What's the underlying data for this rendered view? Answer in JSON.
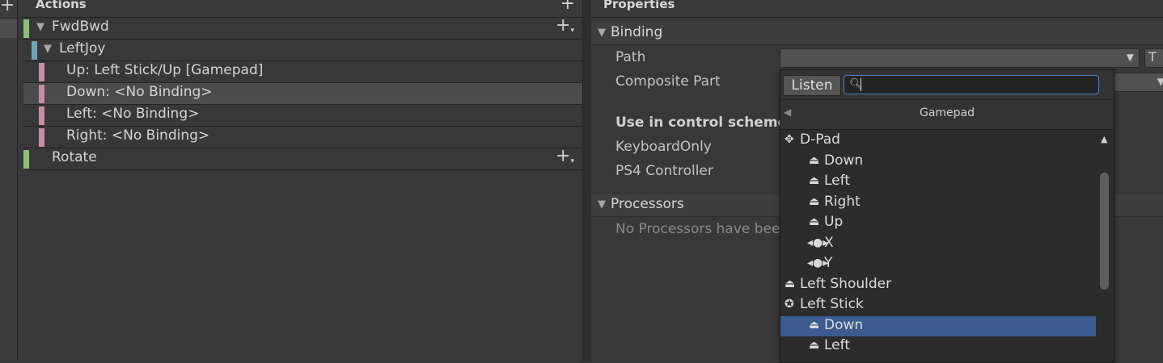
{
  "actions_panel": {
    "title": "Actions",
    "rows": [
      {
        "label": "FwdBwd",
        "type": "action"
      },
      {
        "label": "LeftJoy",
        "type": "composite"
      },
      {
        "label": "Up: Left Stick/Up [Gamepad]",
        "type": "part"
      },
      {
        "label": "Down: <No Binding>",
        "type": "part",
        "selected": true
      },
      {
        "label": "Left: <No Binding>",
        "type": "part"
      },
      {
        "label": "Right: <No Binding>",
        "type": "part"
      },
      {
        "label": "Rotate",
        "type": "action"
      }
    ],
    "colors": {
      "action": "#8cc07a",
      "composite": "#6fa3b5",
      "part": "#c98aa8"
    }
  },
  "properties_panel": {
    "title": "Properties",
    "binding_section": "Binding",
    "path_label": "Path",
    "composite_part_label": "Composite Part",
    "control_schemes_label": "Use in control scheme",
    "schemes": [
      "KeyboardOnly",
      "PS4 Controller"
    ],
    "processors_section": "Processors",
    "no_processors_text": "No Processors have bee",
    "t_button": "T"
  },
  "dropdown": {
    "listen_label": "Listen",
    "search_value": "",
    "crumb": "Gamepad",
    "items": [
      {
        "label": "D-Pad",
        "icon": "dpad-icon",
        "indent": 0
      },
      {
        "label": "Down",
        "icon": "button-icon",
        "indent": 1
      },
      {
        "label": "Left",
        "icon": "button-icon",
        "indent": 1
      },
      {
        "label": "Right",
        "icon": "button-icon",
        "indent": 1
      },
      {
        "label": "Up",
        "icon": "button-icon",
        "indent": 1
      },
      {
        "label": "X",
        "icon": "axis-icon",
        "indent": 1
      },
      {
        "label": "Y",
        "icon": "axis-icon",
        "indent": 1
      },
      {
        "label": "Left Shoulder",
        "icon": "button-icon",
        "indent": 0
      },
      {
        "label": "Left Stick",
        "icon": "stick-icon",
        "indent": 0
      },
      {
        "label": "Down",
        "icon": "button-icon",
        "indent": 1,
        "selected": true
      },
      {
        "label": "Left",
        "icon": "button-icon",
        "indent": 1
      }
    ],
    "selection_color": "#3b5b8f"
  }
}
